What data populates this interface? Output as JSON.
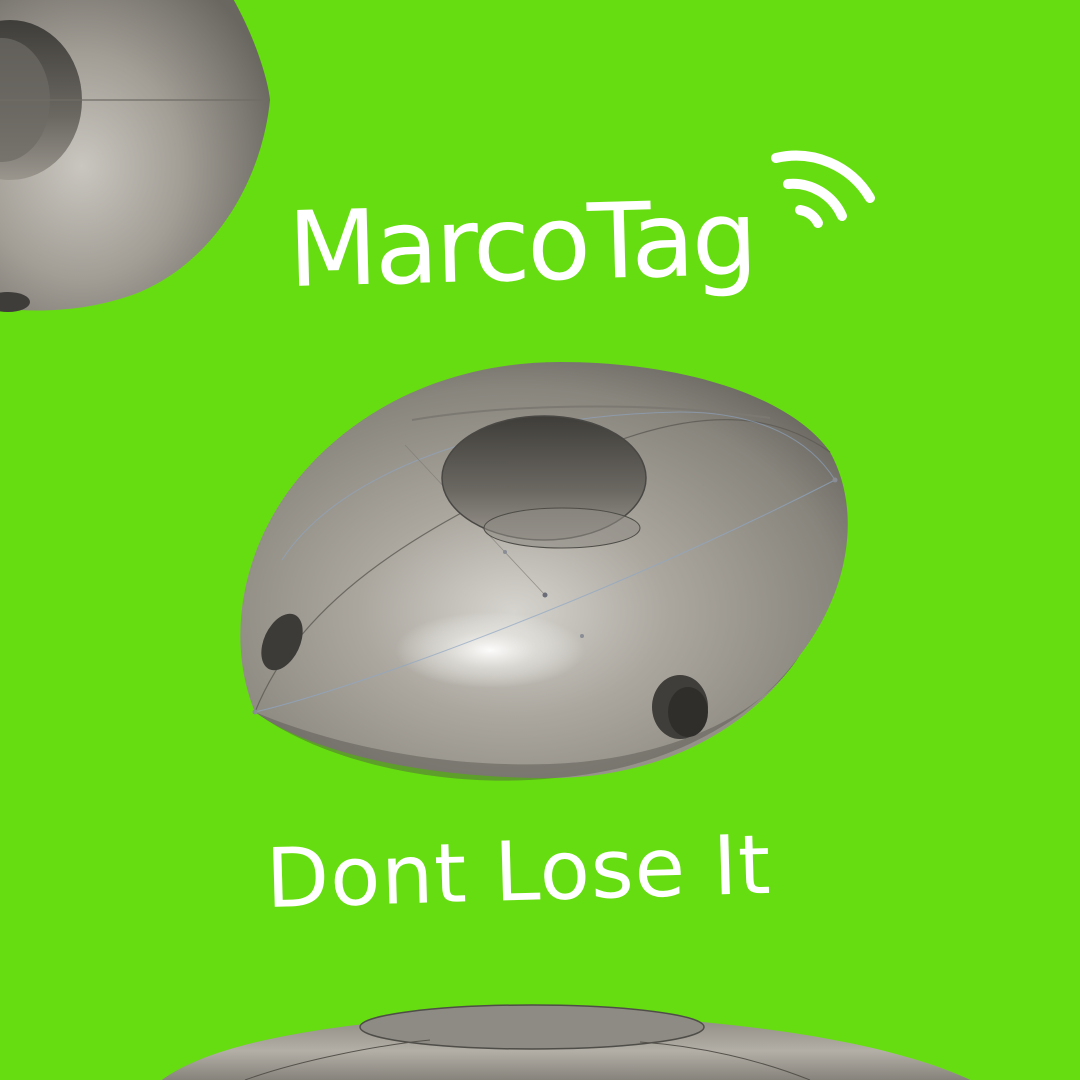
{
  "brand": {
    "title": "MarcoTag",
    "icon": "wireless-signal-icon"
  },
  "tagline": "Dont Lose It",
  "colors": {
    "background": "#66dd10",
    "text": "#ffffff",
    "device_metal": "#a8a49c"
  }
}
